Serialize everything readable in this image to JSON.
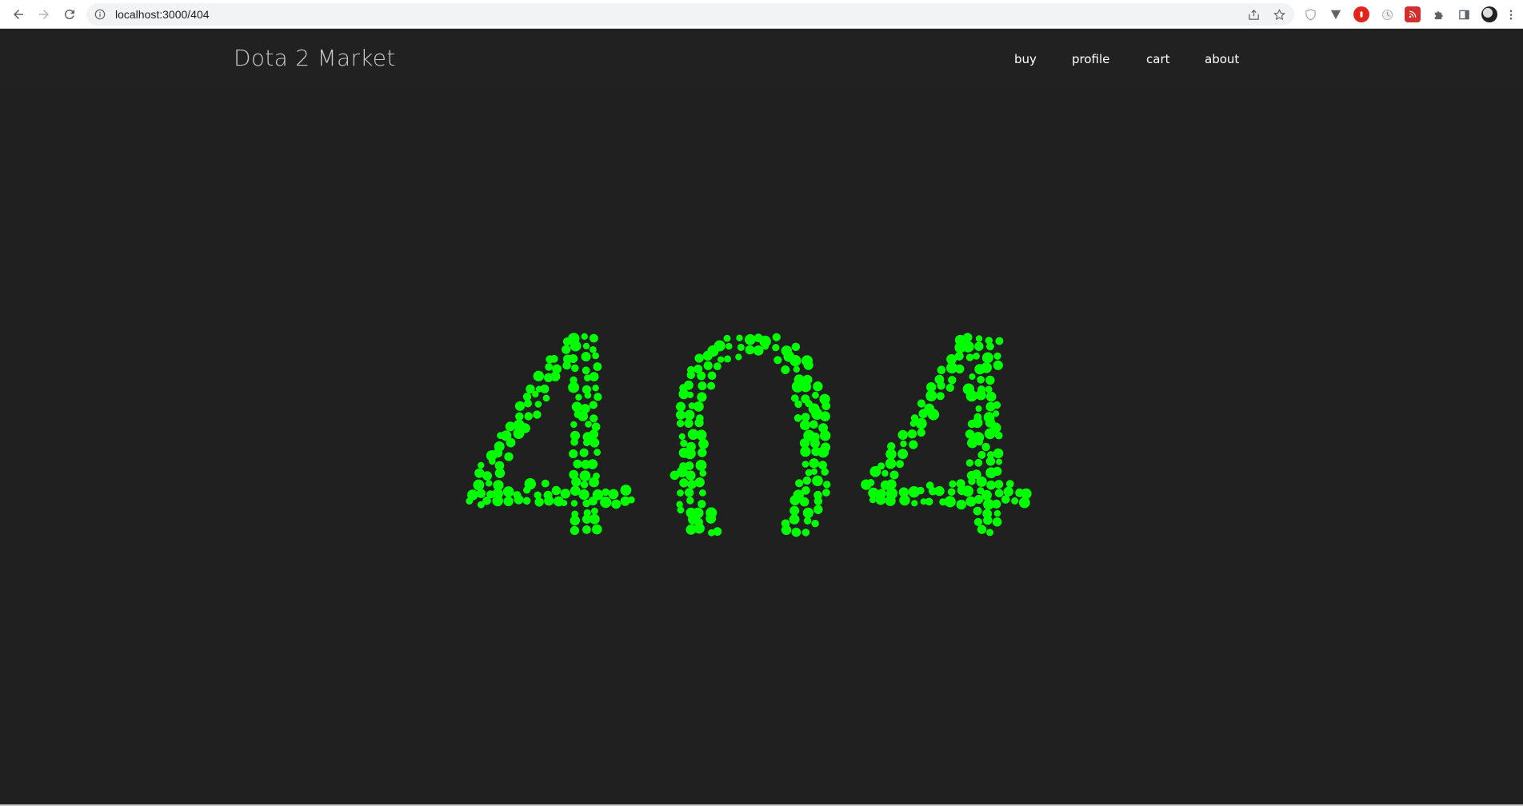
{
  "browser": {
    "url": "localhost:3000/404",
    "icons": [
      "back-icon",
      "forward-icon",
      "reload-icon",
      "info-icon",
      "share-icon",
      "star-icon",
      "shield-ext-icon",
      "vpn-ext-icon",
      "adblock-ext-icon",
      "clock-ext-icon",
      "rss-ext-icon",
      "puzzle-icon",
      "sidebar-icon",
      "profile-avatar",
      "menu-icon"
    ]
  },
  "site": {
    "brand": "Dota 2 Market",
    "nav": {
      "buy": "buy",
      "profile": "profile",
      "cart": "cart",
      "about": "about"
    }
  },
  "error": {
    "text": "404",
    "color": "#00ff00",
    "background": "#202020"
  }
}
